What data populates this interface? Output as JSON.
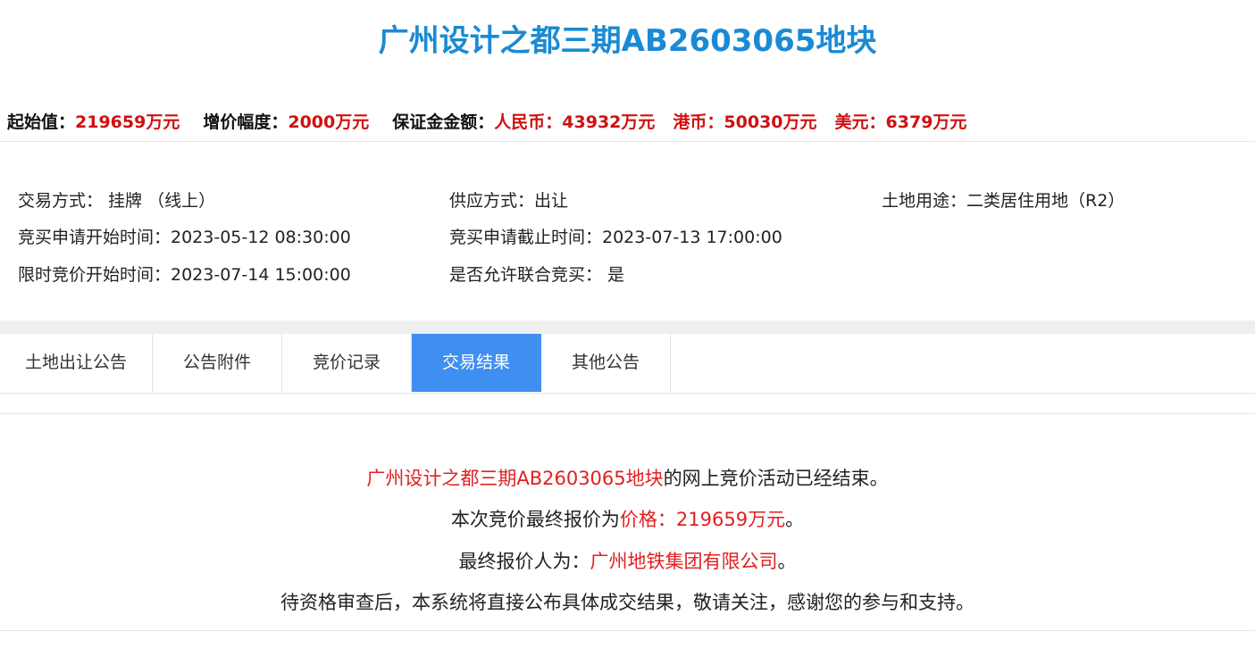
{
  "page_title": "广州设计之都三期AB2603065地块",
  "price_bar": {
    "start_label": "起始值：",
    "start_value": "219659万元",
    "increment_label": "增价幅度：",
    "increment_value": "2000万元",
    "deposit_label": "保证金金额：",
    "rmb_label": "人民币：",
    "rmb_value": "43932万元",
    "hkd_label": "港币：",
    "hkd_value": "50030万元",
    "usd_label": "美元：",
    "usd_value": "6379万元"
  },
  "info": {
    "trade_method": "交易方式： 挂牌 （线上）",
    "supply_method": "供应方式：出让",
    "land_use": "土地用途：二类居住用地（R2）",
    "apply_start": "竞买申请开始时间：2023-05-12 08:30:00",
    "apply_end": "竞买申请截止时间：2023-07-13 17:00:00",
    "bid_start": "限时竞价开始时间：2023-07-14 15:00:00",
    "joint_bid": "是否允许联合竞买： 是"
  },
  "tabs": [
    {
      "label": "土地出让公告",
      "active": false
    },
    {
      "label": "公告附件",
      "active": false
    },
    {
      "label": "竞价记录",
      "active": false
    },
    {
      "label": "交易结果",
      "active": true
    },
    {
      "label": "其他公告",
      "active": false
    }
  ],
  "result": {
    "line1_parcel": "广州设计之都三期AB2603065地块",
    "line1_text": "的网上竞价活动已经结束。",
    "line2_text": "本次竞价最终报价为",
    "line2_price": "价格：219659万元",
    "line2_end": "。",
    "line3_text": "最终报价人为：",
    "line3_company": "广州地铁集团有限公司",
    "line3_end": "。",
    "line4_text": "待资格审查后，本系统将直接公布具体成交结果，敬请关注，感谢您的参与和支持。"
  },
  "colors": {
    "title_blue": "#1a8ad4",
    "price_red": "#d01010",
    "active_tab_blue": "#3f8ff0",
    "result_red": "#e02020"
  }
}
